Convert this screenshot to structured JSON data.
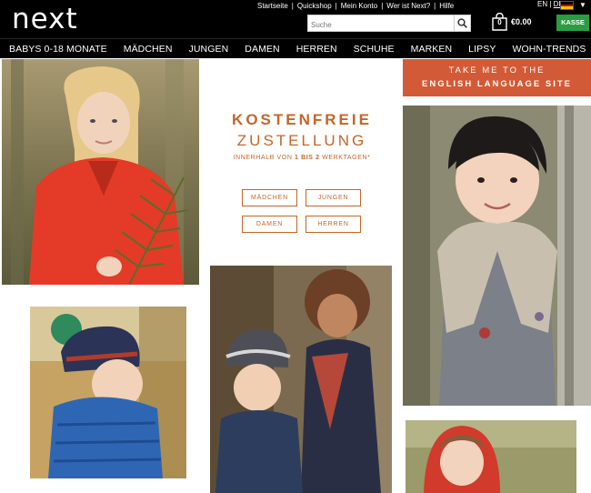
{
  "header": {
    "logo": "next",
    "top_links": [
      "Startseite",
      "Quickshop",
      "Mein Konto",
      "Wer ist Next?",
      "Hilfe"
    ],
    "lang_en": "EN",
    "lang_sep": "|",
    "lang_de": "DE",
    "search_placeholder": "Suche",
    "bag_count": "0",
    "total": "€0.00",
    "checkout": "KASSE"
  },
  "nav": {
    "items": [
      "BABYS 0-18 MONATE",
      "MÄDCHEN",
      "JUNGEN",
      "DAMEN",
      "HERREN",
      "SCHUHE",
      "MARKEN",
      "LIPSY",
      "WOHN-TRENDS"
    ]
  },
  "promo": {
    "title_line1": "KOSTENFREIE",
    "title_line2": "ZUSTELLUNG",
    "sub_pre": "INNERHALB VON ",
    "sub_bold": "1 BIS 2",
    "sub_post": " WERKTAGEN*",
    "buttons": [
      "MÄDCHEN",
      "JUNGEN",
      "DAMEN",
      "HERREN"
    ]
  },
  "english_banner": {
    "line1": "TAKE ME TO THE",
    "line2": "ENGLISH LANGUAGE SITE"
  },
  "colors": {
    "accent": "#c4652a",
    "banner": "#d35a36",
    "checkout": "#2a9d40"
  }
}
